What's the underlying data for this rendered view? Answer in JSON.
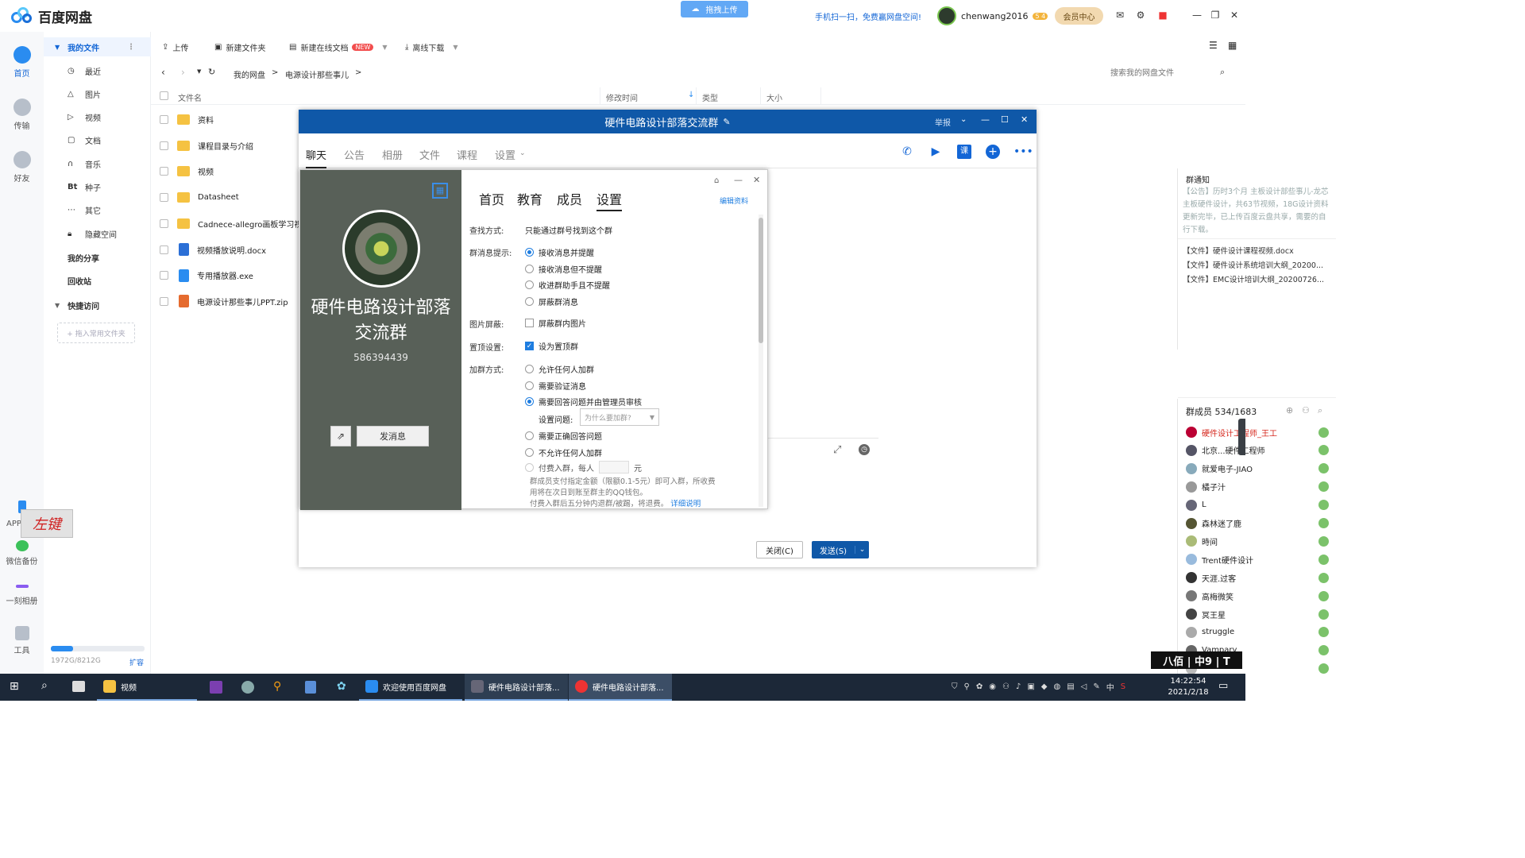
{
  "app": {
    "name": "百度网盘",
    "upload_pill": "拖拽上传",
    "promo": "手机扫一扫，免费赢网盘空间!",
    "username": "chenwang2016",
    "level_badge": "5 4",
    "vip_button": "会员中心"
  },
  "left_nav": [
    {
      "label": "首页",
      "active": true
    },
    {
      "label": "传输"
    },
    {
      "label": "好友"
    },
    {
      "label": "APP下载"
    },
    {
      "label": "微信备份"
    },
    {
      "label": "一刻相册"
    },
    {
      "label": "工具"
    }
  ],
  "overlay_stamp": "左键",
  "sidebar": {
    "my_files": "我的文件",
    "items": [
      "最近",
      "图片",
      "视频",
      "文档",
      "音乐",
      "种子",
      "其它",
      "隐藏空间"
    ],
    "item_icons": [
      "clock-icon",
      "image-icon",
      "play-icon",
      "doc-icon",
      "headphones-icon",
      "bt-icon",
      "more-icon",
      "lock-icon"
    ],
    "bt_glyph": "Bt",
    "my_share": "我的分享",
    "recycle": "回收站",
    "quick_access": "快捷访问",
    "drag_hint": "+ 拖入常用文件夹",
    "storage": "1972G/8212G",
    "storage_used_fraction": 0.24,
    "expand": "扩容"
  },
  "toolbar": {
    "upload": "上传",
    "new_folder": "新建文件夹",
    "new_doc": "新建在线文档",
    "new_badge": "NEW",
    "offline": "离线下载"
  },
  "path": {
    "root": "我的网盘",
    "sep": ">",
    "current": "电源设计那些事儿",
    "sep2": ">"
  },
  "search": {
    "placeholder": "搜索我的网盘文件"
  },
  "columns": {
    "name": "文件名",
    "mtime": "修改时间",
    "type": "类型",
    "size": "大小"
  },
  "files": [
    {
      "name": "资料",
      "kind": "folder"
    },
    {
      "name": "课程目录与介绍",
      "kind": "folder"
    },
    {
      "name": "视频",
      "kind": "folder"
    },
    {
      "name": "Datasheet",
      "kind": "folder"
    },
    {
      "name": "Cadnece-allegro画板学习视频",
      "kind": "folder"
    },
    {
      "name": "视频播放说明.docx",
      "kind": "docx"
    },
    {
      "name": "专用播放器.exe",
      "kind": "exe"
    },
    {
      "name": "电源设计那些事儿PPT.zip",
      "kind": "zip"
    }
  ],
  "qq": {
    "title": "硬件电路设计部落交流群",
    "report": "举报",
    "tabs": [
      "聊天",
      "公告",
      "相册",
      "文件",
      "课程",
      "设置"
    ],
    "course_icon_text": "课",
    "close_btn": "关闭(C)",
    "send_btn": "发送(S)",
    "notice_title": "群通知",
    "notice_text": "【公告】历时3个月 主板设计部些事儿-龙芯主板硬件设计，共63节视频，18G设计资料更新完毕，已上传百度云盘共享，需要的自行下载。",
    "notice_files": [
      "【文件】硬件设计课程视频.docx",
      "【文件】硬件设计系统培训大纲_20200...",
      "【文件】EMC设计培训大纲_20200726..."
    ],
    "members_title": "群成员 534/1683",
    "members": [
      {
        "name": "硬件设计工程师_王工",
        "highlight": true
      },
      {
        "name": "北京...硬件工程师"
      },
      {
        "name": "就爱电子-JIAO"
      },
      {
        "name": "橘子汁"
      },
      {
        "name": "L"
      },
      {
        "name": "森林迷了鹿"
      },
      {
        "name": "時间"
      },
      {
        "name": "Trent硬件设计"
      },
      {
        "name": "天涯.过客"
      },
      {
        "name": "高梅微笑"
      },
      {
        "name": "冥王星"
      },
      {
        "name": "struggle"
      },
      {
        "name": "Vampary"
      },
      {
        "name": "——"
      }
    ]
  },
  "dialog": {
    "group_name": "硬件电路设计部落交流群",
    "group_number": "586394439",
    "send_msg": "发消息",
    "tabs": [
      "首页",
      "教育",
      "成员",
      "设置"
    ],
    "edit_profile": "编辑资料",
    "find_label": "查找方式:",
    "find_value": "只能通过群号找到这个群",
    "notify_label": "群消息提示:",
    "notify_opts": [
      "接收消息并提醒",
      "接收消息但不提醒",
      "收进群助手且不提醒",
      "屏蔽群消息"
    ],
    "image_label": "图片屏蔽:",
    "image_opt": "屏蔽群内图片",
    "top_label": "置顶设置:",
    "top_opt": "设为置顶群",
    "join_label": "加群方式:",
    "join_opts": [
      "允许任何人加群",
      "需要验证消息",
      "需要回答问题并由管理员审核"
    ],
    "question_label": "设置问题:",
    "question_value": "为什么要加群?",
    "join_opts2": [
      "需要正确回答问题",
      "不允许任何人加群"
    ],
    "paid_label": "付费入群，每人",
    "paid_unit": "元",
    "paid_note1": "群成员支付指定金额（限额0.1-5元）即可入群，所收费",
    "paid_note2": "用将在次日到账至群主的QQ钱包。",
    "paid_note3": "付费入群后五分钟内退群/被踢，将退费。",
    "detail_link": "详细说明"
  },
  "taskbar": {
    "items": [
      "视频",
      "欢迎使用百度网盘",
      "硬件电路设计部落...",
      "硬件电路设计部落..."
    ],
    "time": "14:22:54",
    "date": "2021/2/18",
    "ime": "中"
  },
  "watermark": "八佰 | 中9 | T"
}
